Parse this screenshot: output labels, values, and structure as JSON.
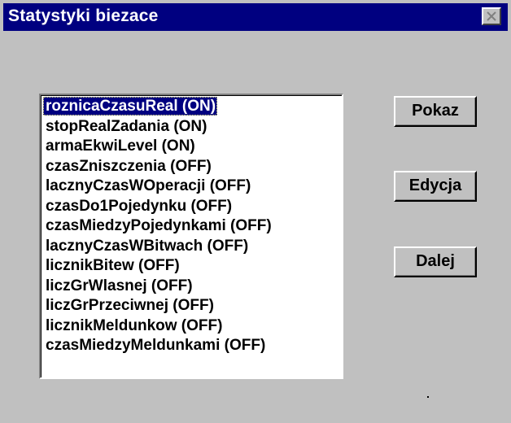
{
  "window": {
    "title": "Statystyki biezace",
    "close_icon": "close-icon"
  },
  "list": {
    "selected_index": 0,
    "items": [
      {
        "label": "roznicaCzasuReal (ON)"
      },
      {
        "label": "stopRealZadania (ON)"
      },
      {
        "label": "armaEkwiLevel (ON)"
      },
      {
        "label": "czasZniszczenia (OFF)"
      },
      {
        "label": "lacznyCzasWOperacji (OFF)"
      },
      {
        "label": "czasDo1Pojedynku (OFF)"
      },
      {
        "label": "czasMiedzyPojedynkami (OFF)"
      },
      {
        "label": "lacznyCzasWBitwach (OFF)"
      },
      {
        "label": "licznikBitew (OFF)"
      },
      {
        "label": "liczGrWlasnej (OFF)"
      },
      {
        "label": "liczGrPrzeciwnej (OFF)"
      },
      {
        "label": "licznikMeldunkow (OFF)"
      },
      {
        "label": "czasMiedzyMeldunkami (OFF)"
      }
    ]
  },
  "buttons": {
    "pokaz": "Pokaz",
    "edycja": "Edycja",
    "dalej": "Dalej"
  },
  "colors": {
    "titlebar": "#000080",
    "face": "#c0c0c0",
    "selection": "#000080"
  }
}
